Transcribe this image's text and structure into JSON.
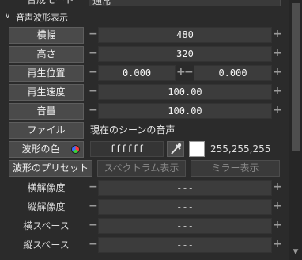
{
  "top": {
    "label": "合成モード",
    "select_value": "通常"
  },
  "section": {
    "title": "音声波形表示"
  },
  "rows": {
    "width": {
      "label": "横幅",
      "value": "480"
    },
    "height": {
      "label": "高さ",
      "value": "320"
    },
    "playback_position": {
      "label": "再生位置",
      "value_a": "0.000",
      "value_b": "0.000"
    },
    "playback_speed": {
      "label": "再生速度",
      "value": "100.00"
    },
    "volume": {
      "label": "音量",
      "value": "100.00"
    },
    "file": {
      "label": "ファイル",
      "value": "現在のシーンの音声"
    },
    "wave_color": {
      "label": "波形の色",
      "hex": "ffffff",
      "rgb": "255,255,255",
      "color": "#ffffff"
    },
    "wave_preset": {
      "label": "波形のプリセット",
      "spectrum_label": "スペクトラム表示",
      "mirror_label": "ミラー表示"
    },
    "h_resolution": {
      "label": "横解像度",
      "value": "---"
    },
    "v_resolution": {
      "label": "縦解像度",
      "value": "---"
    },
    "h_space": {
      "label": "横スペース",
      "value": "---"
    },
    "v_space": {
      "label": "縦スペース",
      "value": "---"
    }
  },
  "icons": {
    "minus": "−",
    "plus": "+",
    "chevron": "∨",
    "scroll_down": "▼"
  }
}
